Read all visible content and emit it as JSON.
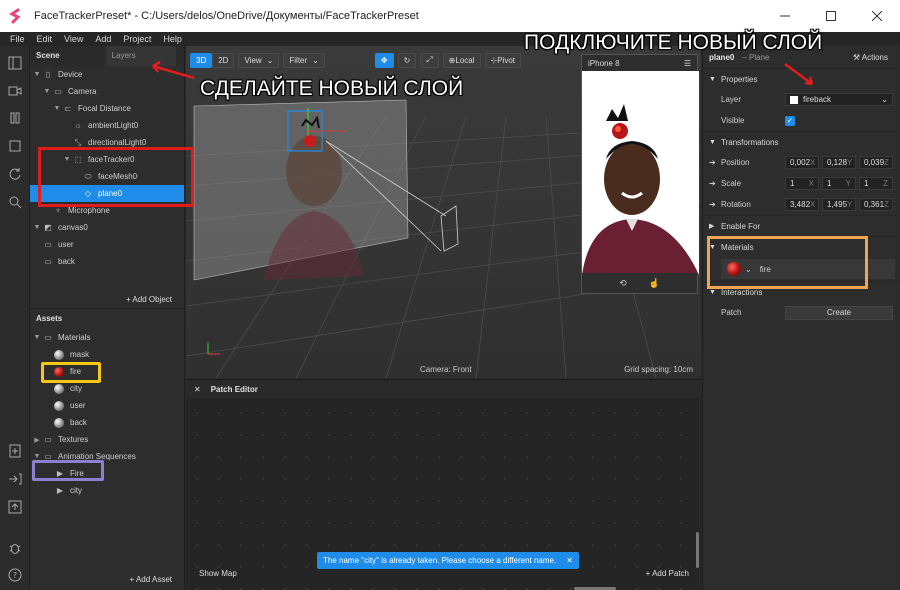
{
  "window": {
    "title": "FaceTrackerPreset* - C:/Users/delos/OneDrive/Документы/FaceTrackerPreset"
  },
  "menu": [
    "File",
    "Edit",
    "View",
    "Add",
    "Project",
    "Help"
  ],
  "scene": {
    "tab_scene": "Scene",
    "tab_layers": "Layers",
    "items": [
      {
        "label": "Device"
      },
      {
        "label": "Camera"
      },
      {
        "label": "Focal Distance"
      },
      {
        "label": "ambientLight0"
      },
      {
        "label": "directionalLight0"
      },
      {
        "label": "faceTracker0"
      },
      {
        "label": "faceMesh0"
      },
      {
        "label": "plane0"
      },
      {
        "label": "Microphone"
      },
      {
        "label": "canvas0"
      },
      {
        "label": "user"
      },
      {
        "label": "back"
      }
    ],
    "add_object": "Add Object"
  },
  "assets": {
    "title": "Assets",
    "items": [
      {
        "label": "Materials"
      },
      {
        "label": "mask"
      },
      {
        "label": "fire"
      },
      {
        "label": "city"
      },
      {
        "label": "user"
      },
      {
        "label": "back"
      },
      {
        "label": "Textures"
      },
      {
        "label": "Animation Sequences"
      },
      {
        "label": "Fire"
      },
      {
        "label": "city"
      }
    ],
    "add_asset": "Add Asset"
  },
  "viewport": {
    "btn_3d": "3D",
    "btn_2d": "2D",
    "view": "View",
    "filter": "Filter",
    "local": "Local",
    "pivot": "Pivot",
    "camera_label": "Camera: Front",
    "grid_label": "Grid spacing: 10cm"
  },
  "preview": {
    "device": "iPhone 8"
  },
  "patch": {
    "title": "Patch Editor",
    "show_map": "Show Map",
    "add_patch": "Add Patch",
    "toast": "The name \"city\" is already taken. Please choose a different name."
  },
  "inspector": {
    "object": "plane0",
    "type": "– Plane",
    "actions": "Actions",
    "properties": "Properties",
    "layer_label": "Layer",
    "layer_value": "fireback",
    "visible_label": "Visible",
    "transformations": "Transformations",
    "position_label": "Position",
    "position": [
      "0,002",
      "0,128",
      "0,039"
    ],
    "scale_label": "Scale",
    "scale": [
      "1",
      "1",
      "1"
    ],
    "rotation_label": "Rotation",
    "rotation": [
      "3,482",
      "1,495",
      "0,361"
    ],
    "axes": [
      "X",
      "Y",
      "Z"
    ],
    "enable_for": "Enable For",
    "materials": "Materials",
    "material_value": "fire",
    "interactions": "Interactions",
    "patch_label": "Patch",
    "create": "Create"
  },
  "annotations": {
    "new_layer": "СДЕЛАЙТЕ НОВЫЙ СЛОЙ",
    "connect_layer": "ПОДКЛЮЧИТЕ НОВЫЙ СЛОЙ"
  },
  "colors": {
    "accent": "#1e8ce8",
    "red_frame": "#e21b1b",
    "yellow_frame": "#f3c714",
    "purple_frame": "#8d7fd0",
    "orange_frame": "#f0a552"
  }
}
